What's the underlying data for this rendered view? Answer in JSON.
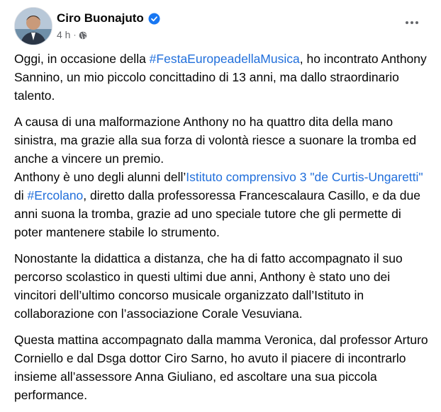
{
  "post": {
    "author": "Ciro Buonajuto",
    "time": "4 h",
    "time_separator": "·",
    "paragraphs": [
      [
        {
          "t": "Oggi, in occasione della "
        },
        {
          "t": "#FestaEuropeadellaMusica",
          "link": true
        },
        {
          "t": ", ho incontrato Anthony Sannino, un mio piccolo concittadino di 13 anni, ma dallo straordinario talento."
        }
      ],
      [
        {
          "t": "A causa di una malformazione Anthony no ha quattro dita della mano sinistra, ma grazie alla sua forza di volontà riesce a suonare la tromba ed anche a vincere un premio."
        },
        {
          "br": true
        },
        {
          "t": "Anthony è uno degli alunni dell’"
        },
        {
          "t": "Istituto comprensivo 3 \"de Curtis-Ungaretti\"",
          "link": true
        },
        {
          "t": " di "
        },
        {
          "t": "#Ercolano",
          "link": true
        },
        {
          "t": ", diretto dalla professoressa Francescalaura Casillo, e da due anni suona la tromba, grazie ad uno speciale tutore che gli permette di poter mantenere stabile lo strumento."
        }
      ],
      [
        {
          "t": "Nonostante la didattica a distanza, che ha di fatto accompagnato il suo percorso scolastico in questi ultimi due anni, Anthony è stato uno dei vincitori dell’ultimo concorso musicale organizzato dall’Istituto in collaborazione con l’associazione Corale Vesuviana."
        }
      ],
      [
        {
          "t": "Questa mattina accompagnato dalla mamma Veronica, dal professor Arturo Corniello e dal Dsga dottor Ciro Sarno, ho avuto il piacere di incontrarlo insieme all’assessore Anna Giuliano, ed ascoltare una sua piccola performance."
        }
      ]
    ]
  },
  "icons": {
    "verified": "verified-badge-icon",
    "privacy": "globe-icon",
    "more": "more-options-icon"
  },
  "colors": {
    "link": "#216fdb",
    "verified": "#1877f2",
    "meta": "#65676b"
  }
}
